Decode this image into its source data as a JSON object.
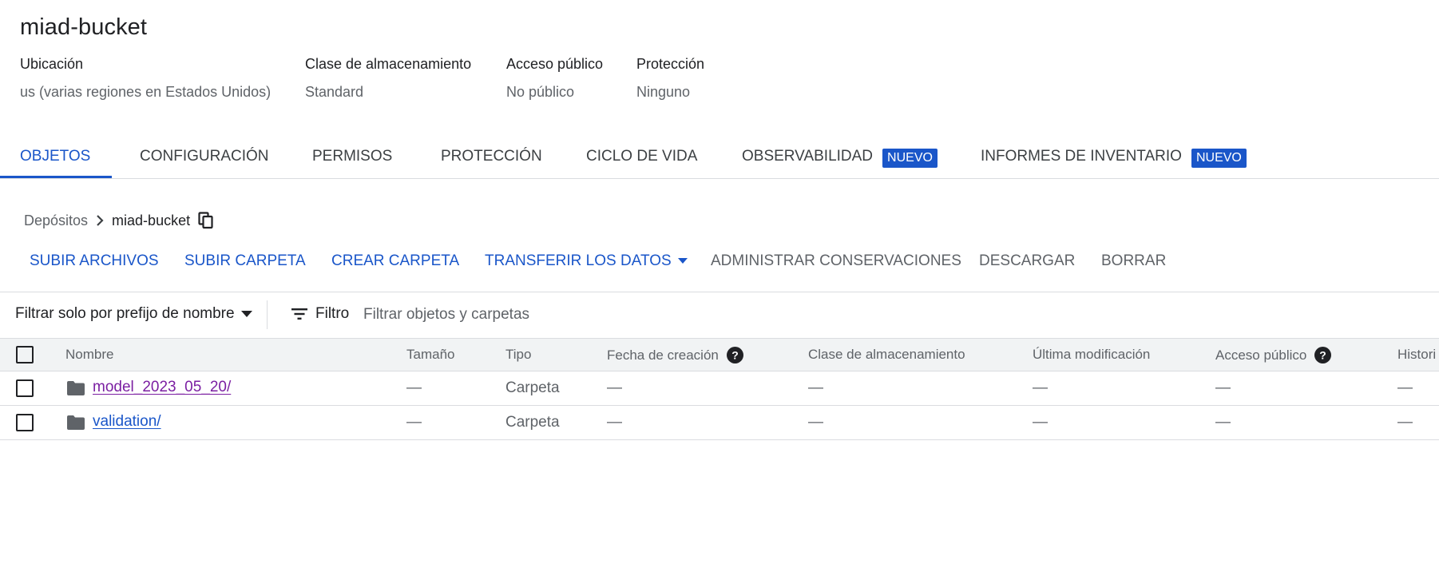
{
  "bucket": {
    "name": "miad-bucket"
  },
  "info": {
    "location": {
      "label": "Ubicación",
      "value": "us (varias regiones en Estados Unidos)"
    },
    "storage_class": {
      "label": "Clase de almacenamiento",
      "value": "Standard"
    },
    "public_access": {
      "label": "Acceso público",
      "value": "No público"
    },
    "protection": {
      "label": "Protección",
      "value": "Ninguno"
    }
  },
  "tabs": [
    {
      "label": "OBJETOS",
      "active": true
    },
    {
      "label": "CONFIGURACIÓN"
    },
    {
      "label": "PERMISOS"
    },
    {
      "label": "PROTECCIÓN"
    },
    {
      "label": "CICLO DE VIDA"
    },
    {
      "label": "OBSERVABILIDAD",
      "badge": "NUEVO"
    },
    {
      "label": "INFORMES DE INVENTARIO",
      "badge": "NUEVO"
    }
  ],
  "breadcrumb": {
    "root": "Depósitos",
    "current": "miad-bucket"
  },
  "actions": {
    "upload_files": "SUBIR ARCHIVOS",
    "upload_folder": "SUBIR CARPETA",
    "create_folder": "CREAR CARPETA",
    "transfer": "TRANSFERIR LOS DATOS",
    "manage_holds": "ADMINISTRAR CONSERVACIONES",
    "download": "DESCARGAR",
    "delete": "BORRAR"
  },
  "filter": {
    "prefix_label": "Filtrar solo por prefijo de nombre",
    "filter_label": "Filtro",
    "placeholder": "Filtrar objetos y carpetas"
  },
  "table": {
    "columns": {
      "name": "Nombre",
      "size": "Tamaño",
      "type": "Tipo",
      "created": "Fecha de creación",
      "storage_class": "Clase de almacenamiento",
      "modified": "Última modificación",
      "public_access": "Acceso público",
      "history": "Histori"
    },
    "rows": [
      {
        "name": "model_2023_05_20/",
        "size": "—",
        "type": "Carpeta",
        "created": "—",
        "storage_class": "—",
        "modified": "—",
        "public_access": "—",
        "history": "—",
        "visited": true
      },
      {
        "name": "validation/",
        "size": "—",
        "type": "Carpeta",
        "created": "—",
        "storage_class": "—",
        "modified": "—",
        "public_access": "—",
        "history": "—",
        "visited": false
      }
    ]
  },
  "colors": {
    "accent": "#1a56c9",
    "visited_link": "#7b1fa2",
    "text": "#202124",
    "muted": "#5f6368",
    "header_bg": "#f1f3f4",
    "border": "#dadce0"
  },
  "icons": {
    "breadcrumb_separator": "chevron-right-icon",
    "copy": "copy-icon",
    "dropdown": "arrow-drop-down-icon",
    "filter": "filter-list-icon",
    "help": "help-icon",
    "folder": "folder-icon"
  }
}
